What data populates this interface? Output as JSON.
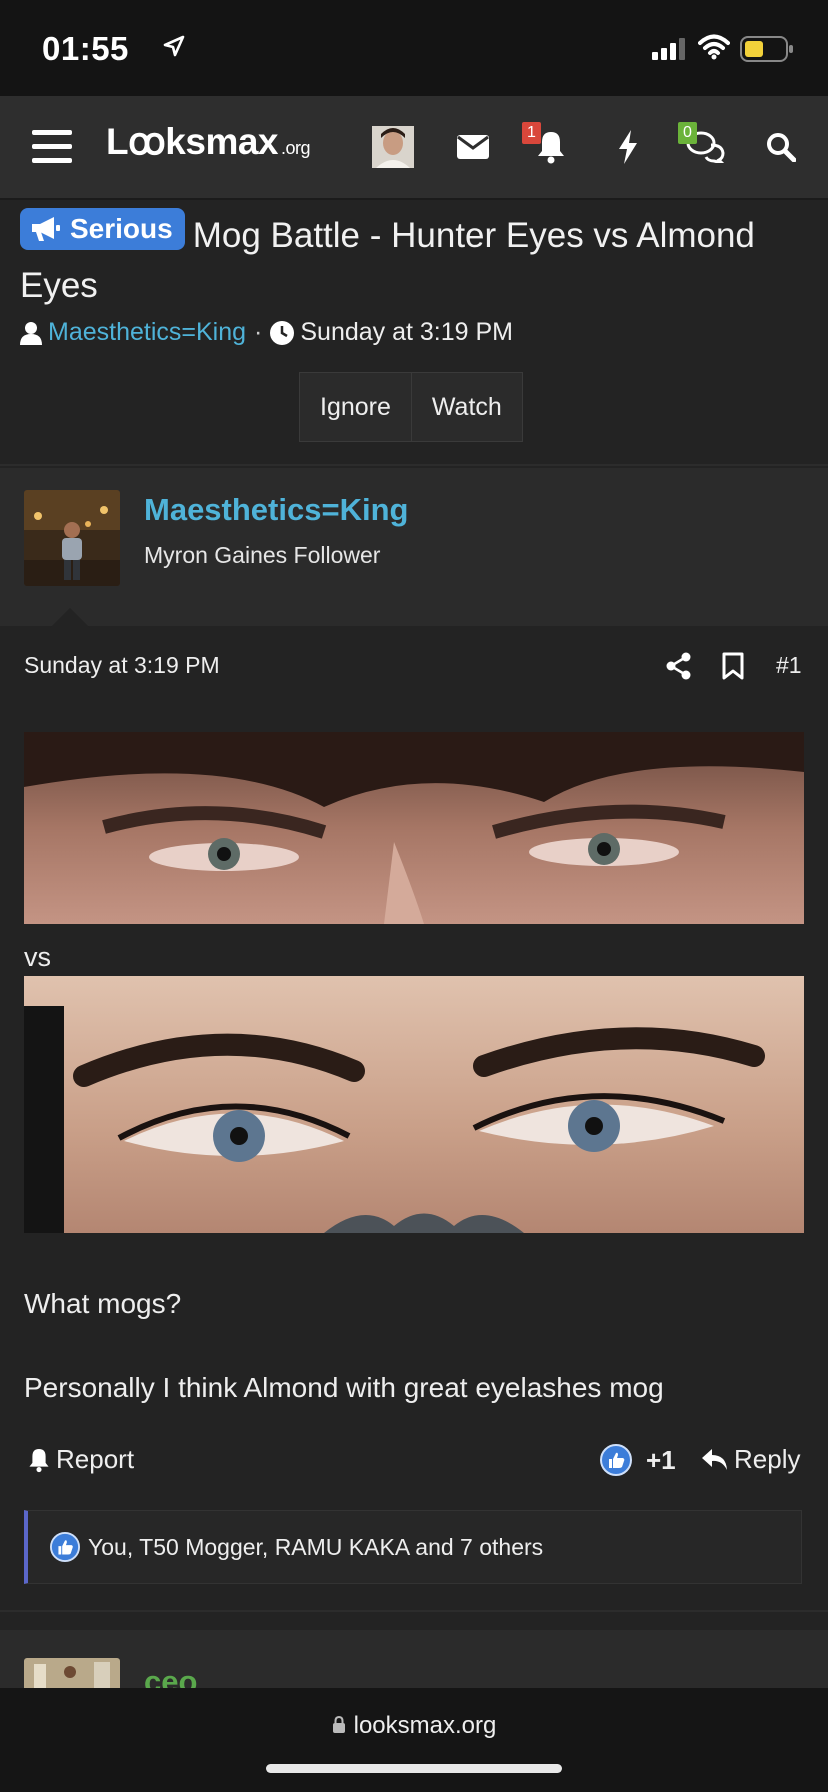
{
  "status": {
    "time": "01:55",
    "icons": [
      "location-arrow-icon",
      "cell-signal-icon",
      "wifi-icon",
      "battery-icon"
    ]
  },
  "nav": {
    "logo_main": "Lꝏksmax",
    "logo_suffix": ".org",
    "alerts_count": "1",
    "conversations_count": "0",
    "icons": [
      "menu-icon",
      "avatar",
      "envelope-icon",
      "bell-icon",
      "bolt-icon",
      "chat-icon",
      "search-icon"
    ],
    "badge_colors": {
      "alerts": "#d9473b",
      "conversations": "#6bb33a"
    }
  },
  "thread": {
    "prefix": "Serious",
    "title": "Mog Battle - Hunter Eyes vs Almond Eyes",
    "author": "Maesthetics=King",
    "date": "Sunday at 3:19 PM",
    "ignore_label": "Ignore",
    "watch_label": "Watch"
  },
  "post": {
    "username": "Maesthetics=King",
    "user_title": "Myron Gaines Follower",
    "date": "Sunday at 3:19 PM",
    "number": "#1",
    "vs_text": "vs",
    "line1": "What mogs?",
    "line2": "Personally I think Almond with great eyelashes mog",
    "report_label": "Report",
    "reaction_score": "+1",
    "reply_label": "Reply",
    "likes_text": "You, T50 Mogger, RAMU KAKA and 7 others"
  },
  "next_post": {
    "username": "ceo"
  },
  "browser": {
    "url": "looksmax.org"
  },
  "colors": {
    "accent": "#4fb3d9",
    "tag": "#3c7dd9",
    "like": "#3c7dd9",
    "likes_border": "#5b67c9",
    "next_user": "#5aa84c"
  }
}
